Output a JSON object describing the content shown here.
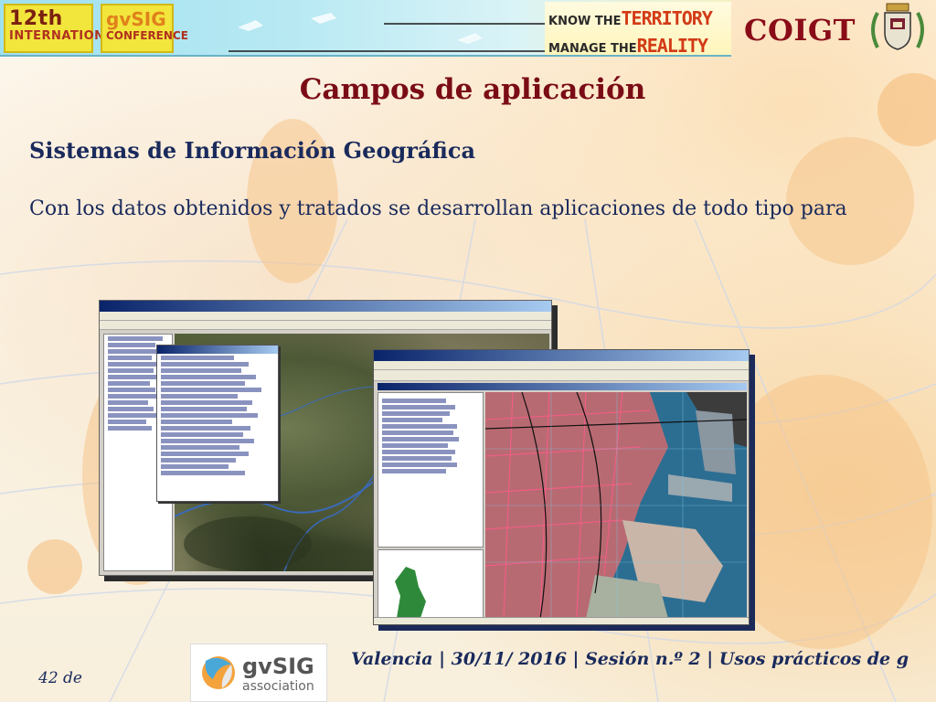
{
  "banner": {
    "logo_12th_top": "12th",
    "logo_12th_bottom": "INTERNATIONAL",
    "logo_conf_top": "gvSIG",
    "logo_conf_bottom": "CONFERENCE",
    "motto_line1_small": "KNOW THE",
    "motto_line1_big": "TERRITORY",
    "motto_line2_small": "MANAGE THE",
    "motto_line2_big": "REALITY"
  },
  "header": {
    "org": "COIGT",
    "crest_icon": "coat-of-arms-icon"
  },
  "slide": {
    "title": "Campos de aplicación",
    "subtitle": "Sistemas de Información Geográfica",
    "body": "Con los datos obtenidos y tratados se desarrollan aplicaciones de todo tipo para"
  },
  "footer": {
    "logo_name": "gvSIG",
    "logo_sub": "association",
    "text": "Valencia | 30/11/ 2016 | Sesión n.º 2 | Usos prácticos de g",
    "page": "42 de"
  },
  "colors": {
    "title": "#7a0c16",
    "text": "#1a2a5c",
    "org": "#8a0c18"
  }
}
